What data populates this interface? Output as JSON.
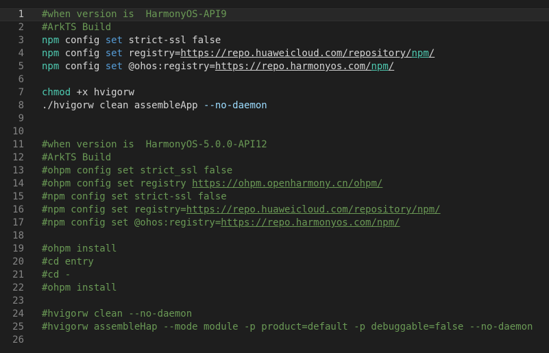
{
  "editor": {
    "lines": [
      {
        "num": "1",
        "segments": [
          {
            "text": "#when version is  HarmonyOS-API9",
            "cls": "c"
          }
        ]
      },
      {
        "num": "2",
        "segments": [
          {
            "text": "#ArkTS Build",
            "cls": "c"
          }
        ]
      },
      {
        "num": "3",
        "segments": [
          {
            "text": "npm",
            "cls": "s"
          },
          {
            "text": " config ",
            "cls": ""
          },
          {
            "text": "set",
            "cls": "k"
          },
          {
            "text": " strict-ssl false",
            "cls": ""
          }
        ]
      },
      {
        "num": "4",
        "segments": [
          {
            "text": "npm",
            "cls": "s"
          },
          {
            "text": " config ",
            "cls": ""
          },
          {
            "text": "set",
            "cls": "k"
          },
          {
            "text": " registry=",
            "cls": ""
          },
          {
            "text": "https://repo.huaweicloud.com/repository/",
            "cls": "u"
          },
          {
            "text": "npm",
            "cls": "u s"
          },
          {
            "text": "/",
            "cls": "u"
          }
        ]
      },
      {
        "num": "5",
        "segments": [
          {
            "text": "npm",
            "cls": "s"
          },
          {
            "text": " config ",
            "cls": ""
          },
          {
            "text": "set",
            "cls": "k"
          },
          {
            "text": " @ohos:registry=",
            "cls": ""
          },
          {
            "text": "https://repo.harmonyos.com/",
            "cls": "u"
          },
          {
            "text": "npm",
            "cls": "u s"
          },
          {
            "text": "/",
            "cls": "u"
          }
        ]
      },
      {
        "num": "6",
        "segments": []
      },
      {
        "num": "7",
        "segments": [
          {
            "text": "chmod",
            "cls": "s"
          },
          {
            "text": " +x hvigorw",
            "cls": ""
          }
        ]
      },
      {
        "num": "8",
        "segments": [
          {
            "text": "./hvigorw clean assembleApp ",
            "cls": ""
          },
          {
            "text": "--no-daemon",
            "cls": "v"
          }
        ]
      },
      {
        "num": "9",
        "segments": []
      },
      {
        "num": "10",
        "segments": []
      },
      {
        "num": "11",
        "segments": [
          {
            "text": "#when version is  HarmonyOS-5.0.0-API12",
            "cls": "c"
          }
        ]
      },
      {
        "num": "12",
        "segments": [
          {
            "text": "#ArkTS Build",
            "cls": "c"
          }
        ]
      },
      {
        "num": "13",
        "segments": [
          {
            "text": "#ohpm config set strict_ssl false",
            "cls": "c"
          }
        ]
      },
      {
        "num": "14",
        "segments": [
          {
            "text": "#ohpm config set registry ",
            "cls": "c"
          },
          {
            "text": "https://ohpm.openharmony.cn/ohpm/",
            "cls": "c u"
          }
        ]
      },
      {
        "num": "15",
        "segments": [
          {
            "text": "#npm config set strict-ssl false",
            "cls": "c"
          }
        ]
      },
      {
        "num": "16",
        "segments": [
          {
            "text": "#npm config set registry=",
            "cls": "c"
          },
          {
            "text": "https://repo.huaweicloud.com/repository/npm/",
            "cls": "c u"
          }
        ]
      },
      {
        "num": "17",
        "segments": [
          {
            "text": "#npm config set @ohos:registry=",
            "cls": "c"
          },
          {
            "text": "https://repo.harmonyos.com/npm/",
            "cls": "c u"
          }
        ]
      },
      {
        "num": "18",
        "segments": []
      },
      {
        "num": "19",
        "segments": [
          {
            "text": "#ohpm install",
            "cls": "c"
          }
        ]
      },
      {
        "num": "20",
        "segments": [
          {
            "text": "#cd entry",
            "cls": "c"
          }
        ]
      },
      {
        "num": "21",
        "segments": [
          {
            "text": "#cd -",
            "cls": "c"
          }
        ]
      },
      {
        "num": "22",
        "segments": [
          {
            "text": "#ohpm install",
            "cls": "c"
          }
        ]
      },
      {
        "num": "23",
        "segments": []
      },
      {
        "num": "24",
        "segments": [
          {
            "text": "#hvigorw clean --no-daemon",
            "cls": "c"
          }
        ]
      },
      {
        "num": "25",
        "segments": [
          {
            "text": "#hvigorw assembleHap --mode module -p product=default -p debuggable=false --no-daemon",
            "cls": "c"
          }
        ]
      },
      {
        "num": "26",
        "segments": []
      }
    ],
    "current_line": "1",
    "colors": {
      "background": "#1e1e1e",
      "comment": "#6a9955",
      "keyword": "#569cd6",
      "command": "#4ec9b0",
      "flag": "#9cdcfe",
      "line_number": "#858585"
    }
  }
}
